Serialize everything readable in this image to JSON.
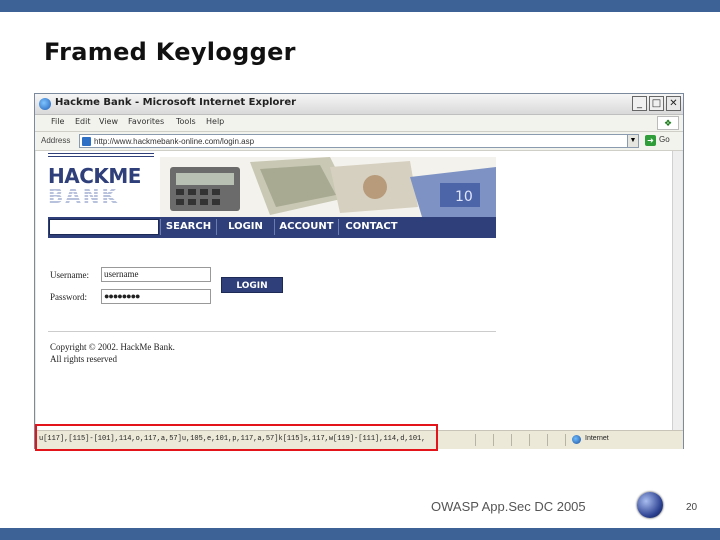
{
  "slide": {
    "title": "Framed Keylogger",
    "footer": "OWASP App.Sec DC 2005",
    "page_number": "20"
  },
  "browser": {
    "window_title": "Hackme Bank - Microsoft Internet Explorer",
    "menu": [
      "File",
      "Edit",
      "View",
      "Favorites",
      "Tools",
      "Help"
    ],
    "address_label": "Address",
    "url": "http://www.hackmebank-online.com/login.asp",
    "go_label": "Go",
    "status_text": "u[117],[115]-[101],114,o,117,a,57]u,105,e,101,p,117,a,57]k[115]s,117,w[119]-[111],114,d,101,",
    "zone_label": "Internet"
  },
  "page": {
    "logo_line1": "HACKME",
    "logo_line2": "BANK",
    "nav": [
      "SEARCH",
      "LOGIN",
      "ACCOUNT",
      "CONTACT"
    ],
    "username_label": "Username:",
    "username_value": "username",
    "password_label": "Password:",
    "password_value": "●●●●●●●●",
    "login_button": "LOGIN",
    "copyright_line1": "Copyright © 2002. HackMe Bank.",
    "copyright_line2": "All rights reserved"
  },
  "colors": {
    "slide_bar": "#3d6396",
    "bank_navy": "#2e3f7a",
    "highlight": "#e4141b"
  }
}
